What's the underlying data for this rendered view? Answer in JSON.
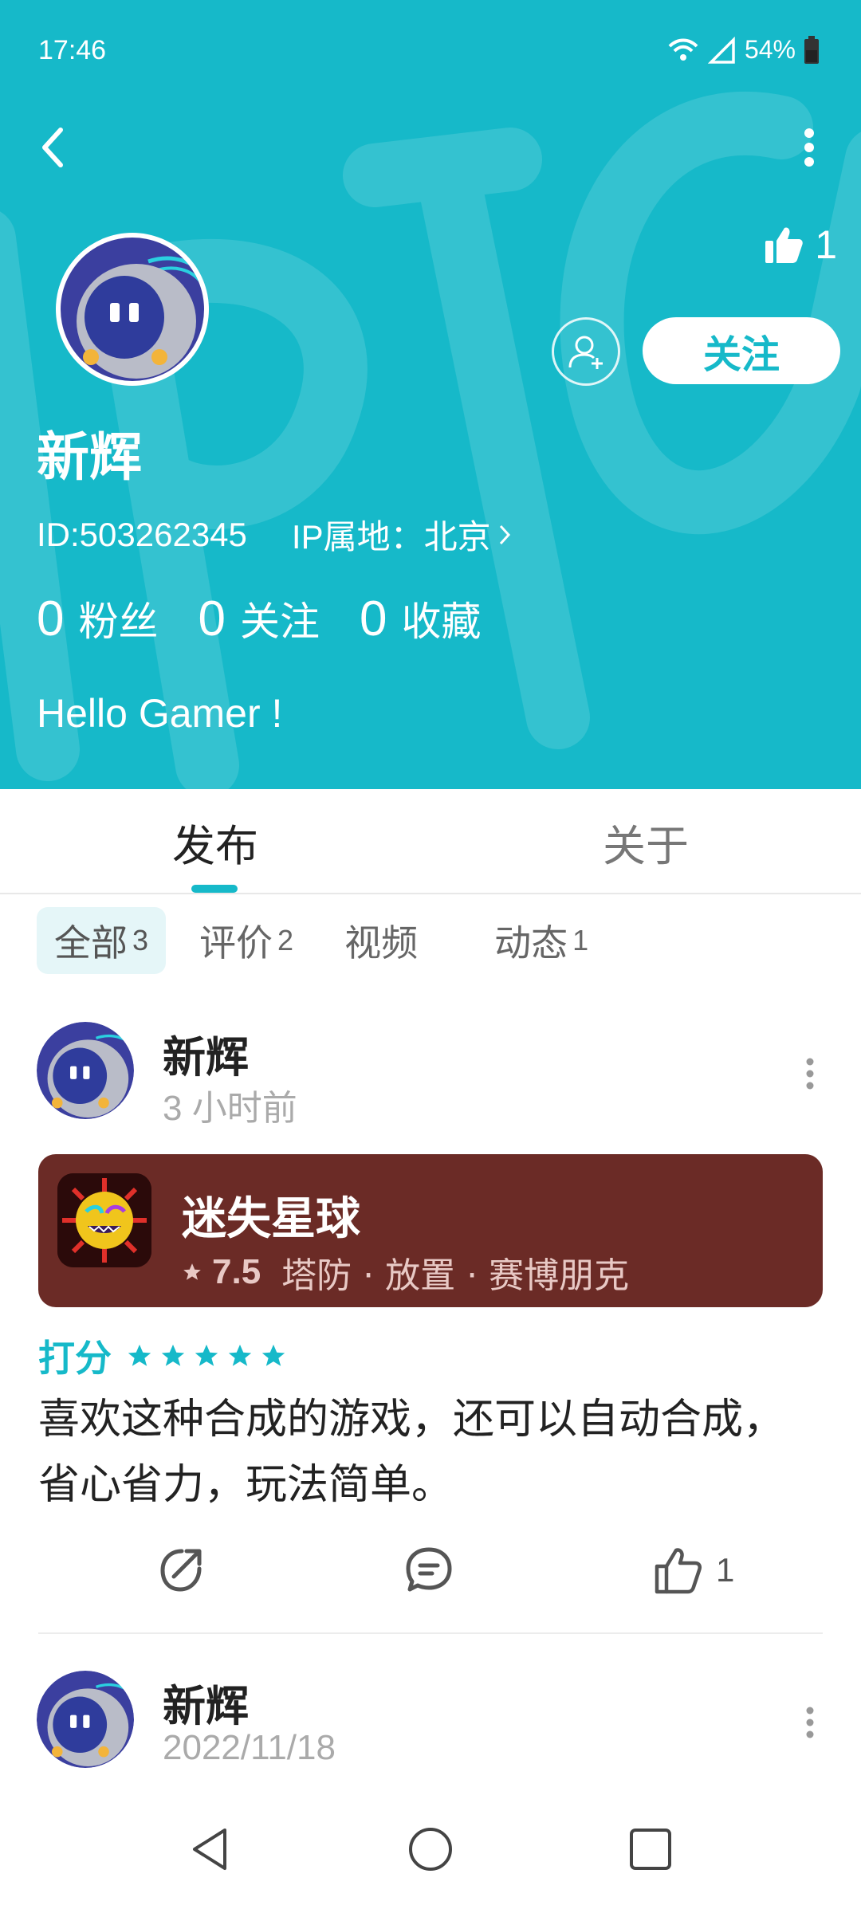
{
  "status_bar": {
    "time": "17:46",
    "battery": "54%"
  },
  "profile": {
    "likes_count": "1",
    "name": "新辉",
    "follow_label": "关注",
    "id_text": "ID:503262345",
    "ip_text": "IP属地：北京",
    "stats": [
      {
        "num": "0",
        "label": "粉丝"
      },
      {
        "num": "0",
        "label": "关注"
      },
      {
        "num": "0",
        "label": "收藏"
      }
    ],
    "bio": "Hello Gamer !"
  },
  "tabs": [
    {
      "label": "发布",
      "active": true
    },
    {
      "label": "关于",
      "active": false
    }
  ],
  "filters": [
    {
      "label": "全部",
      "count": "3",
      "active": true
    },
    {
      "label": "评价",
      "count": "2",
      "active": false
    },
    {
      "label": "视频",
      "count": "",
      "active": false
    },
    {
      "label": "动态",
      "count": "1",
      "active": false
    }
  ],
  "posts": [
    {
      "author": "新辉",
      "time": "3 小时前",
      "game": {
        "name": "迷失星球",
        "score": "7.5",
        "tags": "塔防 · 放置 · 赛博朋克",
        "card_color": "#6b2b26"
      },
      "rating_label": "打分",
      "rating_stars": 5,
      "text": "喜欢这种合成的游戏，还可以自动合成，省心省力，玩法简单。",
      "like_count": "1"
    },
    {
      "author": "新辉",
      "time": "2022/11/18"
    }
  ],
  "colors": {
    "accent": "#16b9c9",
    "white": "#ffffff"
  },
  "icons": [
    "back-icon",
    "more-vert-icon",
    "thumb-up-icon",
    "add-friend-icon",
    "chevron-right-icon",
    "share-icon",
    "comment-icon",
    "star-icon",
    "nav-back-icon",
    "nav-home-icon",
    "nav-recents-icon"
  ]
}
